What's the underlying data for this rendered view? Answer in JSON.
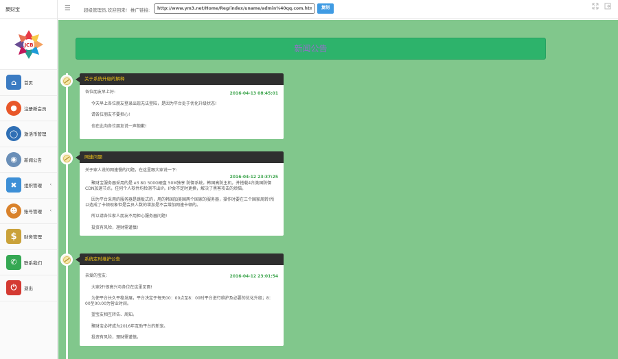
{
  "header": {
    "brand": "聚财宝",
    "welcome": "超级管理员,欢迎回来!",
    "promo_label": "推广链接:",
    "promo_url": "http://www.ym3.net/Home/Reg/index/uname/admin%40qq.com.html",
    "copy_label": "复制"
  },
  "sidebar": {
    "items": [
      {
        "label": "首页",
        "icon": "home-icon",
        "color": "#3b7bc2"
      },
      {
        "label": "注册新会员",
        "icon": "lock-icon",
        "color": "#e8572a"
      },
      {
        "label": "激活币管理",
        "icon": "globe-icon",
        "color": "#2f6fb5"
      },
      {
        "label": "新闻公告",
        "icon": "eye-icon",
        "color": "#6a8fb8"
      },
      {
        "label": "组织管理",
        "icon": "network-icon",
        "color": "#3d8fd6"
      },
      {
        "label": "账号管理",
        "icon": "users-icon",
        "color": "#d9822b"
      },
      {
        "label": "财务管理",
        "icon": "dollar-icon",
        "color": "#caa23a"
      },
      {
        "label": "联系我们",
        "icon": "phone-icon",
        "color": "#35a853"
      },
      {
        "label": "退出",
        "icon": "power-icon",
        "color": "#d43a32"
      }
    ]
  },
  "main": {
    "title": "新闻公告",
    "posts": [
      {
        "title": "关于系统升级的解释",
        "date": "2016-04-13 08:45:01",
        "greeting": "各位朋友早上好:",
        "paragraphs": [
          "今天早上各位朋友登录出现无法登陆，是因为平台处于优化升级状态!",
          "请各位朋友不要担心!",
          "也在此向各位朋友说一声抱歉!"
        ]
      },
      {
        "title": "网速问题",
        "date": "2016-04-12 23:37:25",
        "greeting": "关于家人说的网速慢的问题，在这里跟大家说一下:",
        "paragraphs": [
          "聚财宝服务器采用的是 e3 8G 500G硬盘 50M独享 防御系统。韩国高防主机，并搭载4台美国防御CDN加速节点，任何个人软件均检测不出IP。IP会不定时更换，解决了黑客攻击的烦恼。",
          "因为平台采用的服务器是跳板式的，用的韩国加美国两个国家的服务器，操作时要在三个国家周转!所以造成了卡顿现象但是会员人数的增加是不会增加网速卡顿的。",
          "所以请各位家人朋友不用担心服务器问题!",
          "投资有风险，理财需谨慎!"
        ]
      },
      {
        "title": "系统定时维护公告",
        "date": "2016-04-12 23:01:54",
        "greeting": "亲爱的宝友:",
        "paragraphs": [
          "大家好!很高兴与各位在这里见面!",
          "为使平台长久平稳发展，平台决定于每天00：00点至8：00时平台进行维护及必要的优化升级；8：00至00:00为营业时间。",
          "望宝友相互转告、周知。",
          "聚财宝必将成为2016年互助平台的新宠。",
          "投资有风险，理财需谨慎。"
        ]
      }
    ]
  }
}
